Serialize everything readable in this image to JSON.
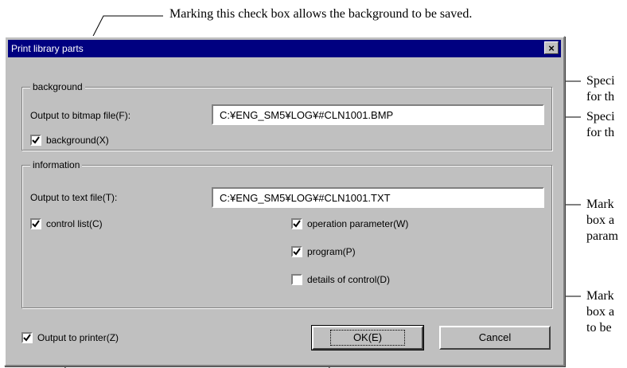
{
  "callouts": {
    "top": "Marking this check box allows the background to be saved.",
    "r1": [
      "Speci",
      "for th"
    ],
    "r2": [
      "Speci",
      "for th"
    ],
    "r3": [
      "Mark",
      "box a",
      "param"
    ],
    "r4": [
      "Mark",
      "box a",
      "to be"
    ]
  },
  "dialog": {
    "title": "Print library parts",
    "close": "×",
    "background_group": {
      "label": "background",
      "field_label": "Output to bitmap file(F):",
      "field_value": "C:¥ENG_SM5¥LOG¥#CLN1001.BMP",
      "checkbox_label": "background(X)",
      "checked": true
    },
    "information_group": {
      "label": "information",
      "field_label": "Output to text file(T):",
      "field_value": "C:¥ENG_SM5¥LOG¥#CLN1001.TXT",
      "control_list": "control list(C)",
      "operation_parameter": "operation parameter(W)",
      "program": "program(P)",
      "details_of_control": "details of control(D)"
    },
    "output_to_printer": "Output to printer(Z)",
    "ok": "OK(E)",
    "cancel": "Cancel"
  }
}
